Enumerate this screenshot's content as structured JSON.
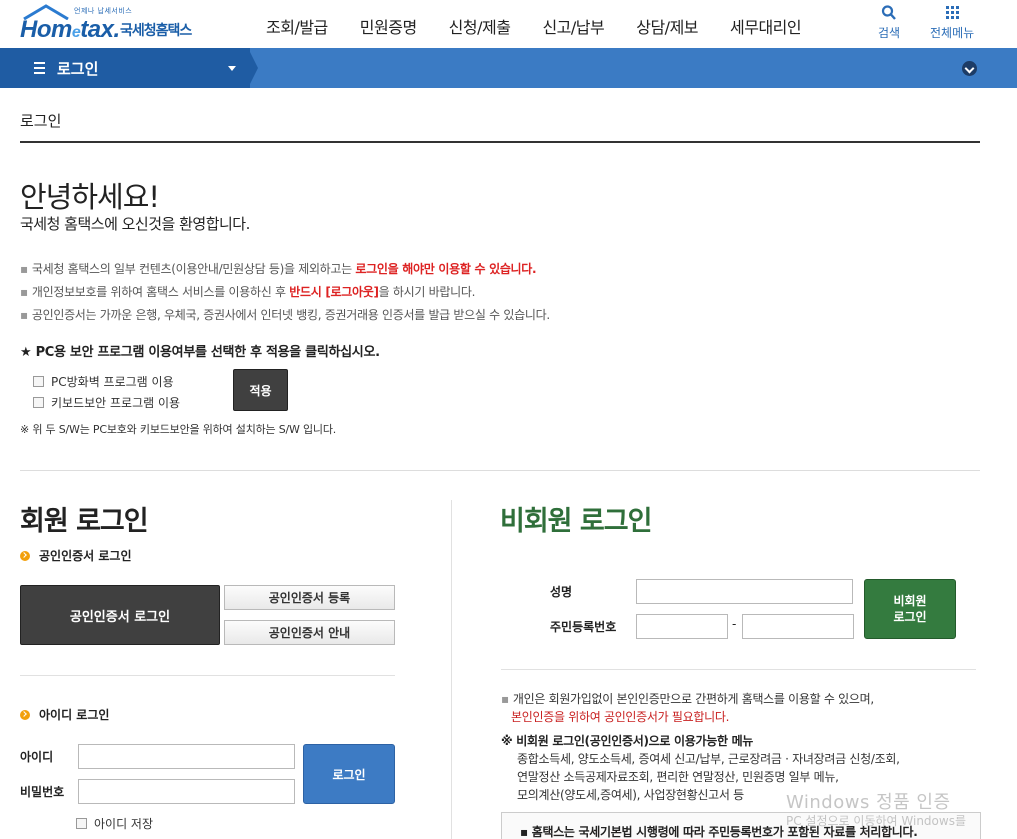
{
  "header": {
    "logo_small": "언제나 납세서비스",
    "logo_main_a": "Hom",
    "logo_main_e": "e",
    "logo_main_b": "tax.",
    "logo_kor": "국세청홈택스",
    "gnb": [
      "조회/발급",
      "민원증명",
      "신청/제출",
      "신고/납부",
      "상담/제보",
      "세무대리인"
    ],
    "search_label": "검색",
    "all_menu_label": "전체메뉴"
  },
  "navbar": {
    "label": "로그인"
  },
  "breadcrumb": "로그인",
  "intro": {
    "hello": "안녕하세요!",
    "welcome": "국세청 홈택스에 오신것을 환영합니다.",
    "note1_a": "국세청 홈택스의 일부 컨텐츠(이용안내/민원상담 등)을 제외하고는 ",
    "note1_b": "로그인을 해야만 이용할 수 있습니다.",
    "note2_a": "개인정보보호를 위하여 홈택스 서비스를 이용하신 후 ",
    "note2_b": "반드시 [로그아웃]",
    "note2_c": "을 하시기 바랍니다.",
    "note3": "공인인증서는 가까운 은행, 우체국, 증권사에서 인터넷 뱅킹, 증권거래용 인증서를 발급 받으실 수 있습니다."
  },
  "security": {
    "title": "★ PC용 보안 프로그램 이용여부를 선택한 후 적용을 클릭하십시오.",
    "option1": "PC방화벽 프로그램 이용",
    "option2": "키보드보안 프로그램 이용",
    "apply": "적용",
    "note": "※ 위 두 S/W는 PC보호와 키보드보안을 위하여 설치하는 S/W 입니다."
  },
  "member": {
    "title": "회원 로그인",
    "cert_section": "공인인증서 로그인",
    "cert_login": "공인인증서 로그인",
    "cert_register": "공인인증서 등록",
    "cert_guide": "공인인증서 안내",
    "id_section": "아이디 로그인",
    "id_label": "아이디",
    "pw_label": "비밀번호",
    "id_value": "",
    "pw_value": "",
    "login": "로그인",
    "save_id": "아이디 저장"
  },
  "nonmember": {
    "title": "비회원 로그인",
    "name_label": "성명",
    "rrn_label": "주민등록번호",
    "name_value": "",
    "rrn1_value": "",
    "rrn2_value": "",
    "dash": "-",
    "login_line1": "비회원",
    "login_line2": "로그인",
    "note1": "개인은 회원가입없이 본인인증만으로 간편하게 홈택스를 이용할 수 있으며,",
    "note2": "본인인증을 위하여 공인인증서가 필요합니다.",
    "menu_title": "※ 비회원 로그인(공인인증서)으로 이용가능한 메뉴",
    "menu1": "종합소득세, 양도소득세, 증여세 신고/납부, 근로장려금 · 자녀장려금 신청/조회,",
    "menu2": "연말정산 소득공제자료조회, 편리한 연말정산, 민원증명 일부 메뉴,",
    "menu3": "모의계산(양도세,증여세), 사업장현황신고서 등",
    "box_text": "▪ 홈택스는 국세기본법 시행령에 따라 주민등록번호가 포함된 자료를 처리합니다."
  },
  "watermark": {
    "line1": "Windows 정품 인증",
    "line2": "PC 설정으로 이동하여 Windows를"
  },
  "colors": {
    "nav_dark": "#1f5ca3",
    "nav_light": "#3b7bc4",
    "apply_bg": "#404040",
    "login_blue": "#3d7bc4",
    "nonmember_green": "#347b3f",
    "accent_red": "#d22222",
    "nonmember_title": "#2f6f3a",
    "bullet_orange": "#f2a00c"
  }
}
